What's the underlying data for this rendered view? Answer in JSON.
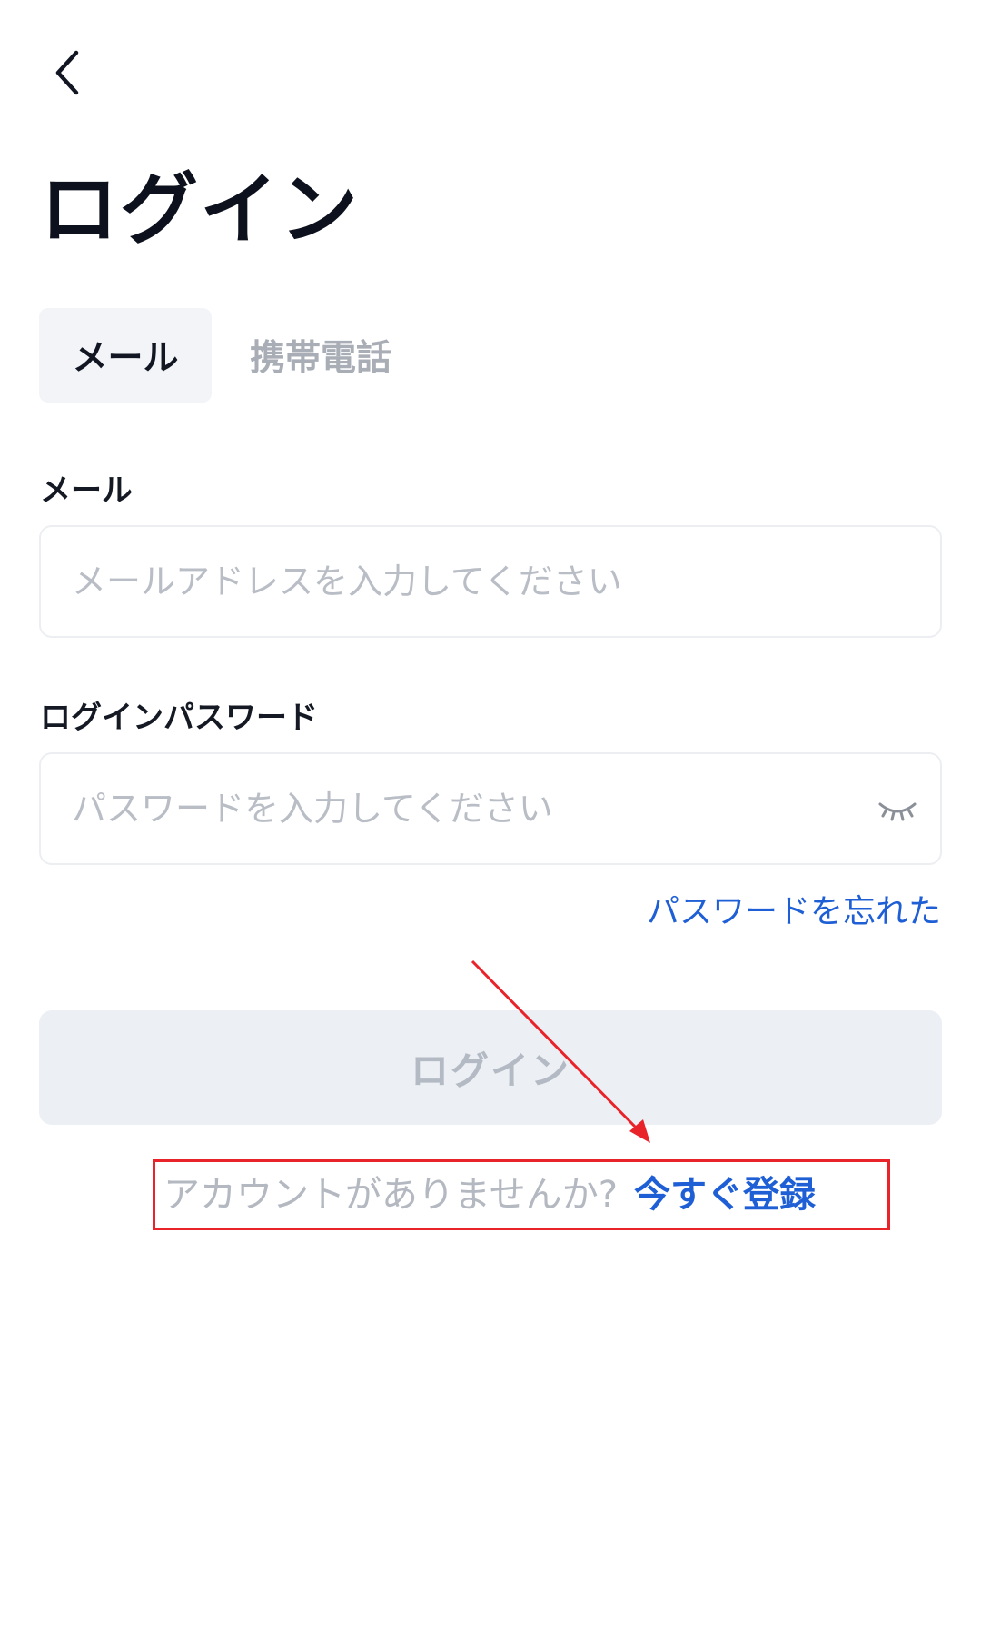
{
  "header": {
    "title": "ログイン"
  },
  "tabs": [
    {
      "label": "メール",
      "active": true
    },
    {
      "label": "携帯電話",
      "active": false
    }
  ],
  "form": {
    "email": {
      "label": "メール",
      "placeholder": "メールアドレスを入力してください",
      "value": ""
    },
    "password": {
      "label": "ログインパスワード",
      "placeholder": "パスワードを入力してください",
      "value": ""
    },
    "forgot_label": "パスワードを忘れた",
    "submit_label": "ログイン"
  },
  "footer": {
    "prompt": "アカウントがありませんか?",
    "register_label": "今すぐ登録"
  },
  "icons": {
    "back": "chevron-left-icon",
    "password_toggle": "eye-closed-icon"
  },
  "colors": {
    "accent": "#1f5fd6",
    "annotation": "#e8232a",
    "button_disabled_bg": "#ecf0f5"
  }
}
